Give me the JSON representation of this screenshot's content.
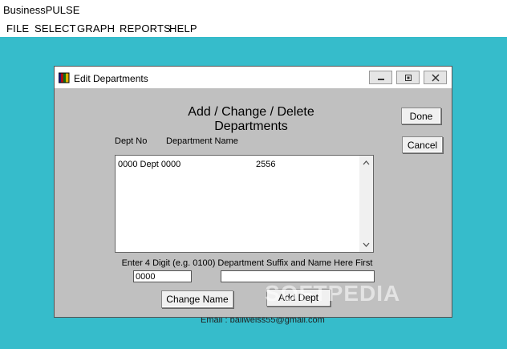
{
  "app": {
    "title": "BusinessPULSE"
  },
  "menu": [
    "FILE",
    "SELECT",
    "GRAPH",
    "REPORTS",
    "HELP"
  ],
  "footer": {
    "email_line": "Email : ballweiss55@gmail.com"
  },
  "watermark": "SOFTPEDIA",
  "dialog": {
    "title": "Edit Departments",
    "heading": "Add / Change / Delete Departments",
    "buttons": {
      "done": "Done",
      "cancel": "Cancel",
      "change_name": "Change Name",
      "add_dept": "Add Dept"
    },
    "columns": {
      "dept_no": "Dept No",
      "dept_name": "Department Name"
    },
    "list": [
      {
        "col1": "0000 Dept 0000",
        "col2": "2556"
      }
    ],
    "hint": "Enter 4 Digit (e.g. 0100) Department Suffix and Name Here First",
    "fields": {
      "suffix_value": "0000",
      "name_value": ""
    }
  }
}
